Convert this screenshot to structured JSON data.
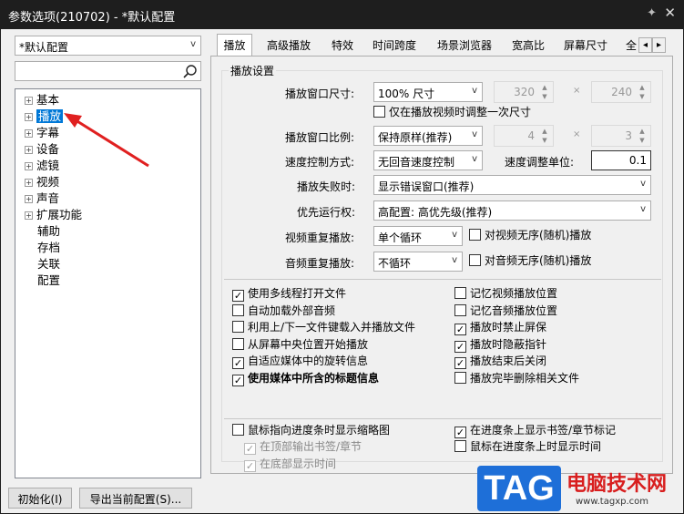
{
  "window": {
    "title": "参数选项(210702) - *默认配置",
    "pin_glyph": "✦",
    "close_glyph": "✕"
  },
  "profile": {
    "value": "*默认配置"
  },
  "search": {
    "placeholder": ""
  },
  "tree": {
    "items": [
      {
        "label": "基本",
        "expand": "+"
      },
      {
        "label": "播放",
        "expand": "+",
        "selected": true
      },
      {
        "label": "字幕",
        "expand": "+"
      },
      {
        "label": "设备",
        "expand": "+"
      },
      {
        "label": "滤镜",
        "expand": "+"
      },
      {
        "label": "视频",
        "expand": "+"
      },
      {
        "label": "声音",
        "expand": "+"
      },
      {
        "label": "扩展功能",
        "expand": "+"
      },
      {
        "label": "辅助",
        "expand": ""
      },
      {
        "label": "存档",
        "expand": ""
      },
      {
        "label": "关联",
        "expand": ""
      },
      {
        "label": "配置",
        "expand": ""
      }
    ]
  },
  "tabs": [
    {
      "label": "播放",
      "active": true
    },
    {
      "label": "高级播放"
    },
    {
      "label": "特效"
    },
    {
      "label": "时间跨度"
    },
    {
      "label": "场景浏览器"
    },
    {
      "label": "宽高比"
    },
    {
      "label": "屏幕尺寸"
    },
    {
      "label": "全"
    }
  ],
  "tab_nav": {
    "left": "◂",
    "right": "▸"
  },
  "group": {
    "title": "播放设置"
  },
  "labels": {
    "window_size": "播放窗口尺寸:",
    "window_ratio": "播放窗口比例:",
    "speed_mode": "速度控制方式:",
    "speed_unit": "速度调整单位:",
    "on_fail": "播放失败时:",
    "priority": "优先运行权:",
    "video_repeat": "视频重复播放:",
    "audio_repeat": "音频重复播放:",
    "times": "×"
  },
  "values": {
    "window_size": "100% 尺寸",
    "w": "320",
    "h": "240",
    "window_ratio": "保持原样(推荐)",
    "ratio_a": "4",
    "ratio_b": "3",
    "speed_mode": "无回音速度控制",
    "speed_unit": "0.1",
    "on_fail": "显示错误窗口(推荐)",
    "priority": "高配置: 高优先级(推荐)",
    "video_repeat": "单个循环",
    "audio_repeat": "不循环"
  },
  "checks": {
    "adjust_once": {
      "label": "仅在播放视频时调整一次尺寸",
      "checked": false
    },
    "video_random": {
      "label": "对视频无序(随机)播放",
      "checked": false
    },
    "audio_random": {
      "label": "对音频无序(随机)播放",
      "checked": false
    },
    "left": [
      {
        "label": "使用多线程打开文件",
        "checked": true
      },
      {
        "label": "自动加载外部音频",
        "checked": false
      },
      {
        "label": "利用上/下一文件键载入并播放文件",
        "checked": false
      },
      {
        "label": "从屏幕中央位置开始播放",
        "checked": false
      },
      {
        "label": "自适应媒体中的旋转信息",
        "checked": true
      },
      {
        "label": "使用媒体中所含的标题信息",
        "checked": true,
        "bold": true
      }
    ],
    "right": [
      {
        "label": "记忆视频播放位置",
        "checked": false
      },
      {
        "label": "记忆音频播放位置",
        "checked": false
      },
      {
        "label": "播放时禁止屏保",
        "checked": true
      },
      {
        "label": "播放时隐蔽指针",
        "checked": true
      },
      {
        "label": "播放结束后关闭",
        "checked": true
      },
      {
        "label": "播放完毕删除相关文件",
        "checked": false
      }
    ],
    "seek_thumb": {
      "label": "鼠标指向进度条时显示缩略图",
      "checked": false
    },
    "top_bookmarks": {
      "label": "在顶部输出书签/章节",
      "checked": true,
      "disabled": true
    },
    "bottom_time": {
      "label": "在底部显示时间",
      "checked": true,
      "disabled": true
    },
    "seek_bookmarks": {
      "label": "在进度条上显示书签/章节标记",
      "checked": true
    },
    "seek_time": {
      "label": "鼠标在进度条上时显示时间",
      "checked": false
    }
  },
  "buttons": {
    "init": "初始化(I)",
    "export": "导出当前配置(S)..."
  },
  "watermark": {
    "logo": "TAG",
    "site": "电脑技术网",
    "url": "www.tagxp.com"
  },
  "colors": {
    "selection": "#0078d7",
    "arrow": "#e02020",
    "logo_bg": "#1e6fd8"
  }
}
